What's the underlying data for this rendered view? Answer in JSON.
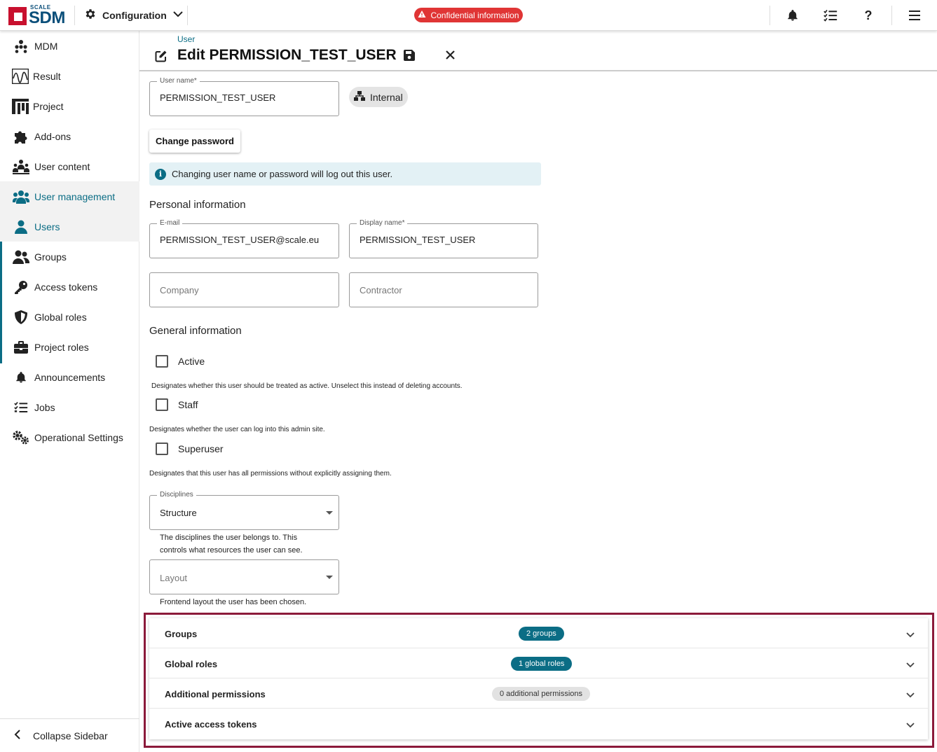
{
  "topbar": {
    "logo_small": "SCALE",
    "logo_big": "SDM",
    "config_label": "Configuration",
    "confidential_label": "Confidential information"
  },
  "sidebar": {
    "items": [
      {
        "label": "MDM",
        "icon": "sitemap-icon"
      },
      {
        "label": "Result",
        "icon": "chart-wave-icon"
      },
      {
        "label": "Project",
        "icon": "project-bars-icon"
      },
      {
        "label": "Add-ons",
        "icon": "puzzle-icon"
      },
      {
        "label": "User content",
        "icon": "users-content-icon"
      },
      {
        "label": "User management",
        "icon": "users-icon"
      },
      {
        "label": "Users",
        "icon": "user-icon"
      },
      {
        "label": "Groups",
        "icon": "group-icon"
      },
      {
        "label": "Access tokens",
        "icon": "key-icon"
      },
      {
        "label": "Global roles",
        "icon": "shield-icon"
      },
      {
        "label": "Project roles",
        "icon": "briefcase-icon"
      },
      {
        "label": "Announcements",
        "icon": "bell-icon"
      },
      {
        "label": "Jobs",
        "icon": "list-check-icon"
      },
      {
        "label": "Operational Settings",
        "icon": "gears-icon"
      }
    ],
    "collapse_label": "Collapse Sidebar"
  },
  "header": {
    "breadcrumb": "User",
    "title": "Edit PERMISSION_TEST_USER"
  },
  "form": {
    "username": {
      "label": "User name*",
      "value": "PERMISSION_TEST_USER"
    },
    "internal_chip": "Internal",
    "change_password": "Change password",
    "info_text": "Changing user name or password will log out this user.",
    "personal_heading": "Personal information",
    "email": {
      "label": "E-mail",
      "value": "PERMISSION_TEST_USER@scale.eu"
    },
    "display_name": {
      "label": "Display name*",
      "value": "PERMISSION_TEST_USER"
    },
    "company": {
      "placeholder": "Company"
    },
    "contractor": {
      "placeholder": "Contractor"
    },
    "general_heading": "General information",
    "active": {
      "label": "Active",
      "hint": "Designates whether this user should be treated as active. Unselect this instead of deleting accounts."
    },
    "staff": {
      "label": "Staff",
      "hint": "Designates whether the user can log into this admin site."
    },
    "superuser": {
      "label": "Superuser",
      "hint": "Designates that this user has all permissions without explicitly assigning them."
    },
    "disciplines": {
      "label": "Disciplines",
      "value": "Structure",
      "help_line1": "The disciplines the user belongs to. This",
      "help_line2": "controls what resources the user can see."
    },
    "layout": {
      "placeholder": "Layout",
      "help": "Frontend layout the user has been chosen."
    }
  },
  "panels": [
    {
      "title": "Groups",
      "badge": "2 groups",
      "badge_style": "teal"
    },
    {
      "title": "Global roles",
      "badge": "1 global roles",
      "badge_style": "teal"
    },
    {
      "title": "Additional permissions",
      "badge": "0 additional permissions",
      "badge_style": "grey"
    },
    {
      "title": "Active access tokens",
      "badge": "",
      "badge_style": "none"
    }
  ],
  "colors": {
    "accent": "#0b6d85",
    "brand": "#0b4f7a",
    "danger": "#e03535",
    "highlight_frame": "#8b1a3a"
  }
}
